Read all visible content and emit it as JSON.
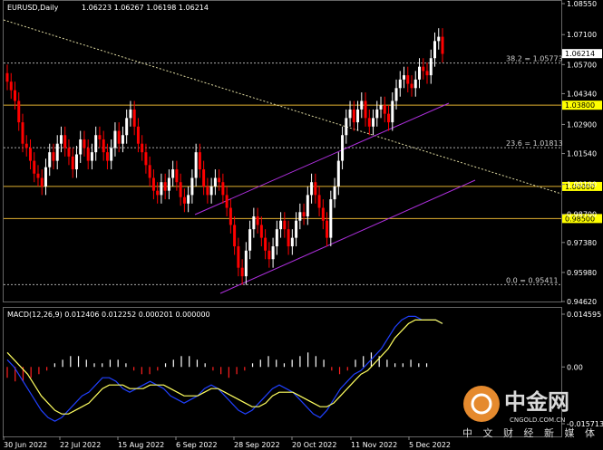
{
  "chart_data": {
    "type": "candlestick",
    "header": {
      "symbol": "EURUSD,Daily",
      "ohlc": "1.06223 1.06267 1.06198 1.06214"
    },
    "price_axis": {
      "ticks": [
        "1.08550",
        "1.07100",
        "1.05700",
        "1.04340",
        "1.02900",
        "1.01540",
        "1.00100",
        "0.98700",
        "0.97380",
        "0.95980",
        "0.94620"
      ],
      "current_price": "1.06214",
      "levels": [
        "1.03800",
        "1.00000",
        "0.98500"
      ]
    },
    "fib_labels": [
      {
        "text": "38.2 = 1.05773",
        "price": 1.05773
      },
      {
        "text": "23.6 = 1.01813",
        "price": 1.01813
      },
      {
        "text": "0.0 = 0.95411",
        "price": 0.95411
      }
    ],
    "hlines": [
      {
        "price": 1.038,
        "label": "1.03800"
      },
      {
        "price": 1.0,
        "label": "1.00000"
      },
      {
        "price": 0.985,
        "label": "0.98500"
      }
    ],
    "x_ticks": [
      "30 Jun 2022",
      "22 Jul 2022",
      "15 Aug 2022",
      "6 Sep 2022",
      "28 Sep 2022",
      "20 Oct 2022",
      "11 Nov 2022",
      "5 Dec 2022"
    ],
    "candles_close": [
      1.049,
      1.045,
      1.04,
      1.03,
      1.02,
      1.018,
      1.012,
      1.006,
      1.004,
      1.0,
      1.009,
      1.016,
      1.012,
      1.02,
      1.024,
      1.018,
      1.014,
      1.008,
      1.015,
      1.022,
      1.018,
      1.012,
      1.016,
      1.024,
      1.022,
      1.016,
      1.012,
      1.018,
      1.026,
      1.02,
      1.024,
      1.032,
      1.036,
      1.028,
      1.02,
      1.016,
      1.01,
      1.004,
      0.998,
      0.996,
      1.002,
      0.998,
      1.004,
      1.008,
      1.002,
      0.995,
      0.992,
      0.996,
      1.004,
      1.016,
      1.008,
      1.0,
      0.996,
      1.0,
      1.004,
      1.002,
      0.996,
      0.99,
      0.982,
      0.972,
      0.962,
      0.958,
      0.97,
      0.98,
      0.986,
      0.982,
      0.976,
      0.97,
      0.966,
      0.972,
      0.98,
      0.984,
      0.98,
      0.972,
      0.976,
      0.984,
      0.988,
      0.986,
      0.996,
      1.002,
      0.996,
      0.99,
      0.984,
      0.976,
      0.994,
      1.0,
      1.012,
      1.024,
      1.032,
      1.036,
      1.03,
      1.036,
      1.04,
      1.032,
      1.028,
      1.032,
      1.036,
      1.038,
      1.034,
      1.03,
      1.04,
      1.046,
      1.05,
      1.052,
      1.048,
      1.046,
      1.05,
      1.056,
      1.054,
      1.052,
      1.06,
      1.068,
      1.07,
      1.062
    ],
    "macd_header": "MACD(12,26,9) 0.012406 0.012252 0.000201 0.000000",
    "macd_axis": {
      "ticks": [
        "0.014595",
        "0.00",
        "-0.015713"
      ]
    },
    "macd_line": [
      0.002,
      0.0,
      -0.003,
      -0.006,
      -0.009,
      -0.012,
      -0.014,
      -0.015,
      -0.014,
      -0.012,
      -0.01,
      -0.008,
      -0.007,
      -0.005,
      -0.003,
      -0.003,
      -0.004,
      -0.006,
      -0.007,
      -0.006,
      -0.005,
      -0.004,
      -0.005,
      -0.006,
      -0.008,
      -0.009,
      -0.01,
      -0.009,
      -0.008,
      -0.006,
      -0.005,
      -0.006,
      -0.008,
      -0.01,
      -0.012,
      -0.013,
      -0.012,
      -0.01,
      -0.008,
      -0.006,
      -0.005,
      -0.006,
      -0.007,
      -0.009,
      -0.011,
      -0.013,
      -0.014,
      -0.012,
      -0.009,
      -0.006,
      -0.004,
      -0.002,
      -0.001,
      0.001,
      0.003,
      0.005,
      0.008,
      0.011,
      0.013,
      0.014,
      0.014,
      0.013,
      0.013,
      0.013,
      0.012
    ],
    "signal_line": [
      0.004,
      0.002,
      0.0,
      -0.002,
      -0.005,
      -0.008,
      -0.01,
      -0.012,
      -0.013,
      -0.013,
      -0.012,
      -0.011,
      -0.01,
      -0.008,
      -0.006,
      -0.005,
      -0.005,
      -0.005,
      -0.006,
      -0.006,
      -0.006,
      -0.005,
      -0.005,
      -0.005,
      -0.006,
      -0.007,
      -0.008,
      -0.008,
      -0.008,
      -0.007,
      -0.006,
      -0.006,
      -0.007,
      -0.008,
      -0.009,
      -0.01,
      -0.011,
      -0.011,
      -0.01,
      -0.008,
      -0.007,
      -0.007,
      -0.007,
      -0.008,
      -0.009,
      -0.01,
      -0.011,
      -0.011,
      -0.01,
      -0.008,
      -0.006,
      -0.004,
      -0.002,
      -0.001,
      0.001,
      0.003,
      0.005,
      0.008,
      0.01,
      0.012,
      0.013,
      0.013,
      0.013,
      0.013,
      0.012
    ],
    "histogram": [
      -0.003,
      -0.004,
      -0.004,
      -0.003,
      -0.002,
      -0.001,
      0.001,
      0.002,
      0.003,
      0.003,
      0.002,
      0.001,
      0.001,
      0.002,
      0.002,
      0.001,
      -0.001,
      -0.002,
      -0.002,
      -0.001,
      0.001,
      0.002,
      0.003,
      0.003,
      0.002,
      0.001,
      -0.001,
      -0.002,
      -0.003,
      -0.002,
      -0.001,
      0.001,
      0.002,
      0.003,
      0.002,
      0.001,
      0.002,
      0.003,
      0.004,
      0.003,
      0.002,
      -0.001,
      -0.002,
      -0.001,
      0.002,
      0.003,
      0.004,
      0.003,
      0.002,
      0.001,
      0.001,
      0.002,
      0.001,
      0.001,
      0.0,
      0.0
    ],
    "colors": {
      "background": "#000000",
      "bull": "#ffffff",
      "bear": "#ff0000",
      "channel": "#b030e0",
      "hline": "#e0b030",
      "macd": "#2040ff",
      "signal": "#ffff60",
      "hist_pos": "#ffffff",
      "hist_neg": "#ff2020",
      "price_label_bg": "#ffffff",
      "level_label_bg": "#ffff00"
    }
  },
  "watermark": {
    "logo_text": "中金网",
    "site": "CNGOLD.COM.CN",
    "subtitle": "中 文 财 经 新 媒 体"
  }
}
